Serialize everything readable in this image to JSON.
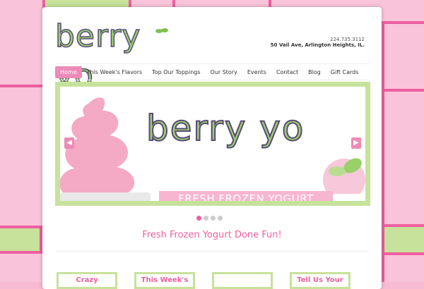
{
  "brand": {
    "name": "berry yo"
  },
  "contact": {
    "phone": "224.735.3112",
    "address": "50 Vail Ave, Arlington Heights, IL."
  },
  "nav": {
    "items": [
      {
        "label": "Home"
      },
      {
        "label": "This Week's Flavors"
      },
      {
        "label": "Top Our Toppings"
      },
      {
        "label": "Our Story"
      },
      {
        "label": "Events"
      },
      {
        "label": "Contact"
      },
      {
        "label": "Blog"
      },
      {
        "label": "Gift Cards"
      }
    ]
  },
  "hero": {
    "title": "berry yo",
    "banner": "FRESH FROZEN YOGURT"
  },
  "tagline": "Fresh Frozen Yogurt Done Fun!",
  "cards": [
    {
      "label": "Crazy"
    },
    {
      "label": "This Week's"
    },
    {
      "label": ""
    },
    {
      "label": "Tell Us Your"
    }
  ],
  "colors": {
    "accent": "#ee5fa0",
    "green": "#c7e29a",
    "pink": "#f7bcd3"
  }
}
